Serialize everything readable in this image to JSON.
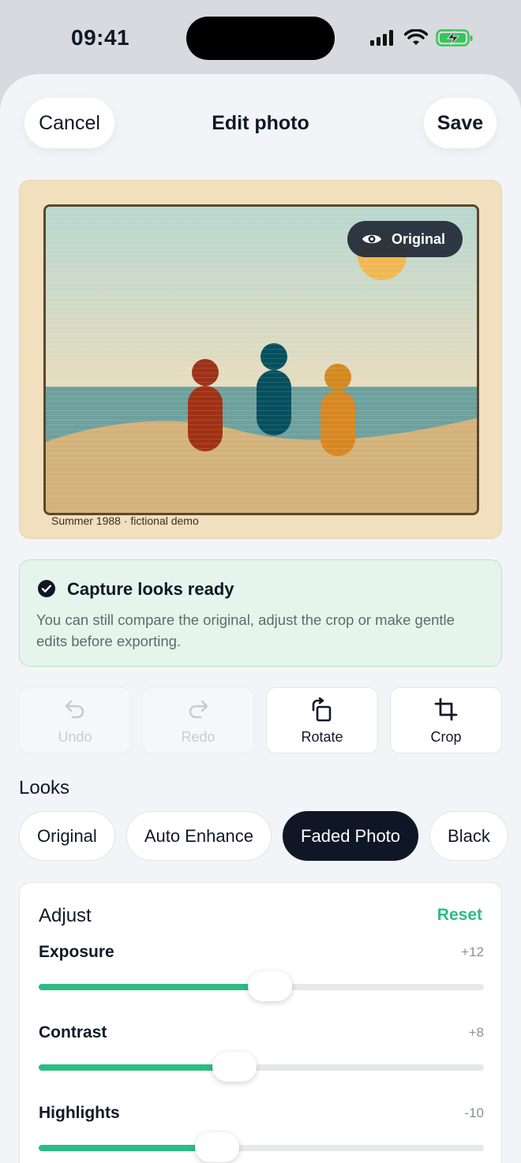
{
  "status": {
    "time": "09:41"
  },
  "header": {
    "cancel": "Cancel",
    "title": "Edit photo",
    "save": "Save"
  },
  "photo": {
    "caption": "Summer 1988 · fictional demo",
    "compare_label": "Original"
  },
  "banner": {
    "title": "Capture looks ready",
    "text": "You can still compare the original, adjust the crop or make gentle edits before exporting."
  },
  "tools": [
    {
      "label": "Undo",
      "icon": "undo-icon",
      "enabled": false
    },
    {
      "label": "Redo",
      "icon": "redo-icon",
      "enabled": false
    },
    {
      "label": "Rotate",
      "icon": "rotate-icon",
      "enabled": true
    },
    {
      "label": "Crop",
      "icon": "crop-icon",
      "enabled": true
    }
  ],
  "looks": {
    "heading": "Looks",
    "items": [
      "Original",
      "Auto Enhance",
      "Faded Photo",
      "Black"
    ],
    "selected": "Faded Photo"
  },
  "adjust": {
    "heading": "Adjust",
    "reset": "Reset",
    "sliders": [
      {
        "name": "Exposure",
        "value": "+12",
        "level": 0.52
      },
      {
        "name": "Contrast",
        "value": "+8",
        "level": 0.44
      },
      {
        "name": "Highlights",
        "value": "-10",
        "level": 0.4
      }
    ]
  },
  "colors": {
    "accent": "#2bbd84",
    "dark": "#0f1726",
    "banner_bg": "#e5f5ec"
  }
}
